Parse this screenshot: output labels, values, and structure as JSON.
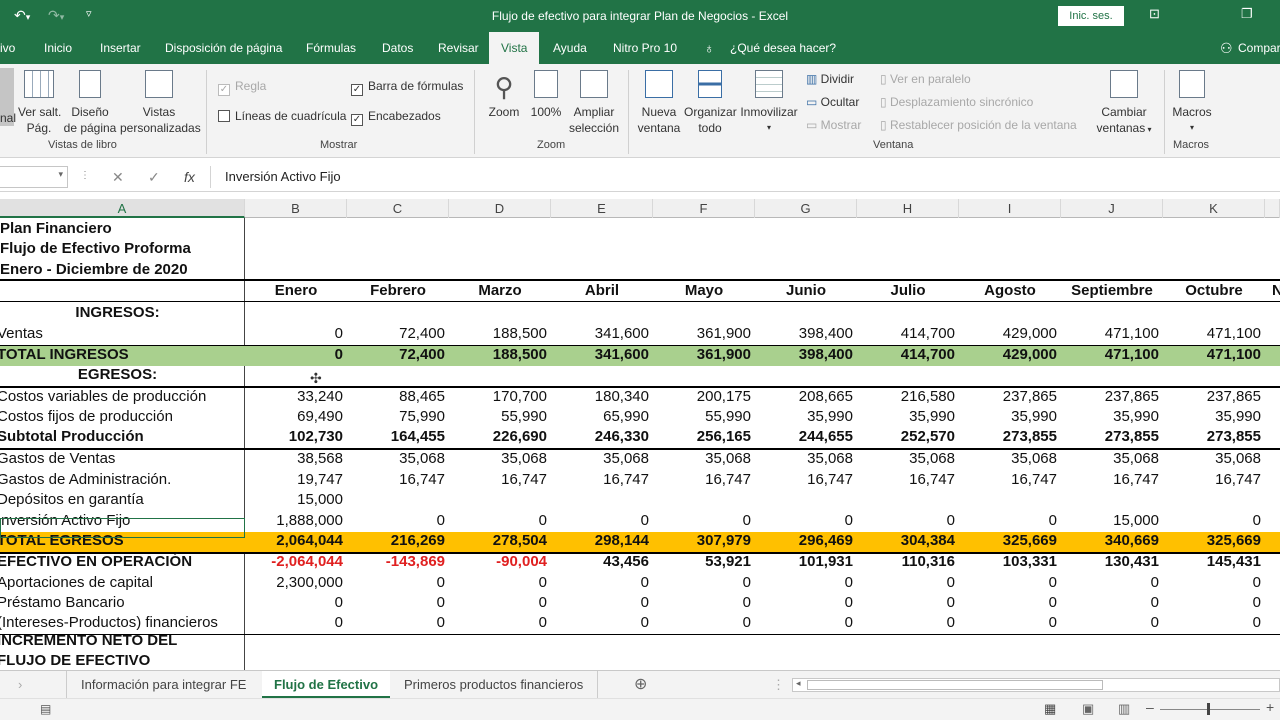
{
  "window": {
    "title": "Flujo de efectivo para integrar Plan de Negocios  -  Excel",
    "signin_label": "Inic. ses."
  },
  "tabs": [
    "ivo",
    "Inicio",
    "Insertar",
    "Disposición de página",
    "Fórmulas",
    "Datos",
    "Revisar",
    "Vista",
    "Ayuda",
    "Nitro Pro 10",
    "¿Qué desea hacer?",
    "Compar"
  ],
  "ribbon": {
    "normal": "nal",
    "page_break": [
      "Ver salt.",
      "Pág."
    ],
    "page_layout": [
      "Diseño",
      "de página"
    ],
    "custom_views": [
      "Vistas",
      "personalizadas"
    ],
    "group_views": "Vistas de libro",
    "regla": "Regla",
    "lineas": "Líneas de cuadrícula",
    "barra": "Barra de fórmulas",
    "encabezados": "Encabezados",
    "group_show": "Mostrar",
    "zoom": "Zoom",
    "zoom100": "100%",
    "zoom_sel": [
      "Ampliar",
      "selección"
    ],
    "group_zoom": "Zoom",
    "new_window": [
      "Nueva",
      "ventana"
    ],
    "arrange": [
      "Organizar",
      "todo"
    ],
    "freeze": "Inmovilizar",
    "split": "Dividir",
    "hide": "Ocultar",
    "unhide": "Mostrar",
    "side_by_side": "Ver en paralelo",
    "sync_scroll": "Desplazamiento sincrónico",
    "reset_pos": "Restablecer posición de la ventana",
    "switch": [
      "Cambiar",
      "ventanas"
    ],
    "group_window": "Ventana",
    "macros": "Macros",
    "group_macros": "Macros"
  },
  "formula_bar": {
    "content": "Inversión Activo Fijo"
  },
  "columns": [
    "A",
    "B",
    "C",
    "D",
    "E",
    "F",
    "G",
    "H",
    "I",
    "J",
    "K"
  ],
  "header_lines": [
    "Plan Financiero",
    "Flujo de Efectivo Proforma",
    "Enero  - Diciembre de 2020"
  ],
  "months": [
    "Enero",
    "Febrero",
    "Marzo",
    "Abril",
    "Mayo",
    "Junio",
    "Julio",
    "Agosto",
    "Septiembre",
    "Octubre",
    "N"
  ],
  "rows": [
    {
      "label": "INGRESOS:",
      "values": []
    },
    {
      "label": "Ventas",
      "values": [
        "0",
        "72,400",
        "188,500",
        "341,600",
        "361,900",
        "398,400",
        "414,700",
        "429,000",
        "471,100",
        "471,100"
      ]
    },
    {
      "label": "TOTAL INGRESOS",
      "values": [
        "0",
        "72,400",
        "188,500",
        "341,600",
        "361,900",
        "398,400",
        "414,700",
        "429,000",
        "471,100",
        "471,100"
      ]
    },
    {
      "label": "EGRESOS:",
      "values": []
    },
    {
      "label": "Costos variables de producción",
      "values": [
        "33,240",
        "88,465",
        "170,700",
        "180,340",
        "200,175",
        "208,665",
        "216,580",
        "237,865",
        "237,865",
        "237,865"
      ]
    },
    {
      "label": "Costos fijos de producción",
      "values": [
        "69,490",
        "75,990",
        "55,990",
        "65,990",
        "55,990",
        "35,990",
        "35,990",
        "35,990",
        "35,990",
        "35,990"
      ]
    },
    {
      "label": "Subtotal Producción",
      "values": [
        "102,730",
        "164,455",
        "226,690",
        "246,330",
        "256,165",
        "244,655",
        "252,570",
        "273,855",
        "273,855",
        "273,855"
      ]
    },
    {
      "label": "Gastos de Ventas",
      "values": [
        "38,568",
        "35,068",
        "35,068",
        "35,068",
        "35,068",
        "35,068",
        "35,068",
        "35,068",
        "35,068",
        "35,068"
      ]
    },
    {
      "label": "Gastos de Administración.",
      "values": [
        "19,747",
        "16,747",
        "16,747",
        "16,747",
        "16,747",
        "16,747",
        "16,747",
        "16,747",
        "16,747",
        "16,747"
      ]
    },
    {
      "label": "Depósitos en garantía",
      "values": [
        "15,000"
      ]
    },
    {
      "label": "Inversión Activo Fijo",
      "values": [
        "1,888,000",
        "0",
        "0",
        "0",
        "0",
        "0",
        "0",
        "0",
        "15,000",
        "0"
      ]
    },
    {
      "label": "TOTAL EGRESOS",
      "values": [
        "2,064,044",
        "216,269",
        "278,504",
        "298,144",
        "307,979",
        "296,469",
        "304,384",
        "325,669",
        "340,669",
        "325,669"
      ]
    },
    {
      "label": "EFECTIVO EN OPERACIÓN",
      "values": [
        "-2,064,044",
        "-143,869",
        "-90,004",
        "43,456",
        "53,921",
        "101,931",
        "110,316",
        "103,331",
        "130,431",
        "145,431"
      ]
    },
    {
      "label": "Aportaciones de capital",
      "values": [
        "2,300,000",
        "0",
        "0",
        "0",
        "0",
        "0",
        "0",
        "0",
        "0",
        "0"
      ]
    },
    {
      "label": "Préstamo Bancario",
      "values": [
        "0",
        "0",
        "0",
        "0",
        "0",
        "0",
        "0",
        "0",
        "0",
        "0"
      ]
    },
    {
      "label": "(Intereses-Productos) financieros",
      "values": [
        "0",
        "0",
        "0",
        "0",
        "0",
        "0",
        "0",
        "0",
        "0",
        "0"
      ]
    },
    {
      "label": "INCREMENTO NETO DEL",
      "values": []
    },
    {
      "label": "FLUJO DE EFECTIVO",
      "values": []
    }
  ],
  "sheets": [
    "Información para integrar FE",
    "Flujo de Efectivo",
    "Primeros productos financieros"
  ],
  "colors": {
    "excel_green": "#217346",
    "total_green": "#a9d08e",
    "total_orange": "#ffc000",
    "negative": "#e02020"
  }
}
